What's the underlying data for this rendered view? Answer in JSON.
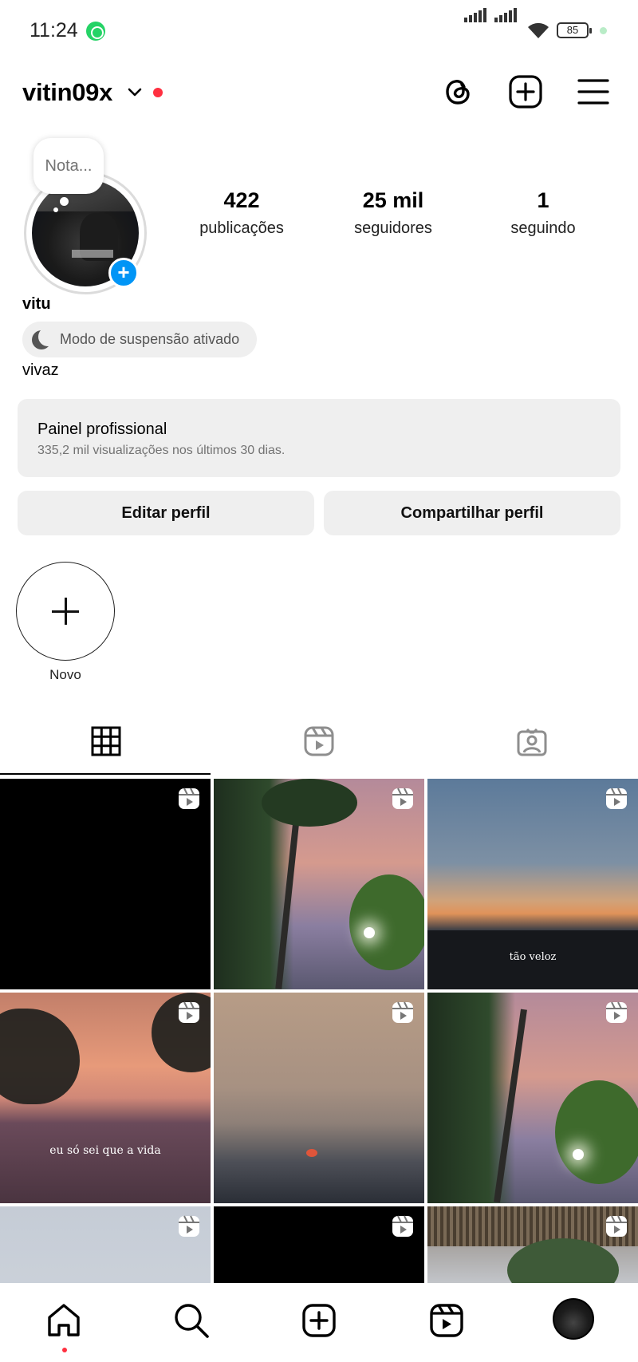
{
  "status_bar": {
    "time": "11:24",
    "battery": "85"
  },
  "header": {
    "username": "vitin09x"
  },
  "note": {
    "placeholder": "Nota..."
  },
  "stats": [
    {
      "value": "422",
      "label": "publicações"
    },
    {
      "value": "25 mil",
      "label": "seguidores"
    },
    {
      "value": "1",
      "label": "seguindo"
    }
  ],
  "profile": {
    "display_name": "vitu",
    "status_chip": "Modo de suspensão ativado",
    "bio": "vivaz"
  },
  "pro_panel": {
    "title": "Painel profissional",
    "subtitle": "335,2 mil visualizações nos últimos 30 dias."
  },
  "buttons": {
    "edit": "Editar perfil",
    "share": "Compartilhar perfil"
  },
  "highlights": {
    "new_label": "Novo"
  },
  "tabs": {
    "active": "grid",
    "items": [
      "grid-icon",
      "reels-icon",
      "tagged-icon"
    ]
  },
  "grid_captions": {
    "post_3": "tão veloz",
    "post_4": "eu só sei que a vida"
  },
  "colors": {
    "accent_blue": "#0095f6",
    "notification_red": "#ff3040",
    "chip_bg": "#efefef"
  }
}
